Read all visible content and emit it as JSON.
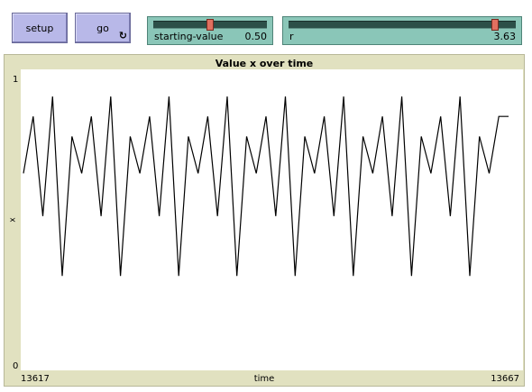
{
  "buttons": {
    "setup_label": "setup",
    "go_label": "go",
    "go_icon": "forever-loop-icon"
  },
  "sliders": [
    {
      "label": "starting-value",
      "value": "0.50",
      "min": 0,
      "max": 1,
      "fraction": 0.5
    },
    {
      "label": "r",
      "value": "3.63",
      "min": 0,
      "max": 4,
      "fraction": 0.9075
    }
  ],
  "colors": {
    "button": "#b8b8e8",
    "slider": "#8ac6b8",
    "plot_frame": "#e1e1c0",
    "line": "#000000"
  },
  "chart_data": {
    "type": "line",
    "title": "Value x over time",
    "xlabel": "time",
    "ylabel": "x",
    "xlim": [
      13617,
      13667
    ],
    "ylim": [
      0,
      1
    ],
    "x_tick_labels": [
      "13617",
      "13667"
    ],
    "y_tick_labels": [
      "0",
      "1"
    ],
    "grid": false,
    "x": [
      13617,
      13618,
      13619,
      13620,
      13621,
      13622,
      13623,
      13624,
      13625,
      13626,
      13627,
      13628,
      13629,
      13630,
      13631,
      13632,
      13633,
      13634,
      13635,
      13636,
      13637,
      13638,
      13639,
      13640,
      13641,
      13642,
      13643,
      13644,
      13645,
      13646,
      13647,
      13648,
      13649,
      13650,
      13651,
      13652,
      13653,
      13654,
      13655,
      13656,
      13657,
      13658,
      13659,
      13660,
      13661,
      13662,
      13663,
      13664,
      13665,
      13666,
      13667
    ],
    "series": [
      {
        "values": [
          0.66,
          0.86,
          0.51,
          0.93,
          0.3,
          0.79,
          0.66,
          0.86,
          0.51,
          0.93,
          0.3,
          0.79,
          0.66,
          0.86,
          0.51,
          0.93,
          0.3,
          0.79,
          0.66,
          0.86,
          0.51,
          0.93,
          0.3,
          0.79,
          0.66,
          0.86,
          0.51,
          0.93,
          0.3,
          0.79,
          0.66,
          0.86,
          0.51,
          0.93,
          0.3,
          0.79,
          0.66,
          0.86,
          0.51,
          0.93,
          0.3,
          0.79,
          0.66,
          0.86,
          0.51,
          0.93,
          0.3,
          0.79,
          0.66,
          0.86,
          0.86
        ]
      }
    ]
  }
}
